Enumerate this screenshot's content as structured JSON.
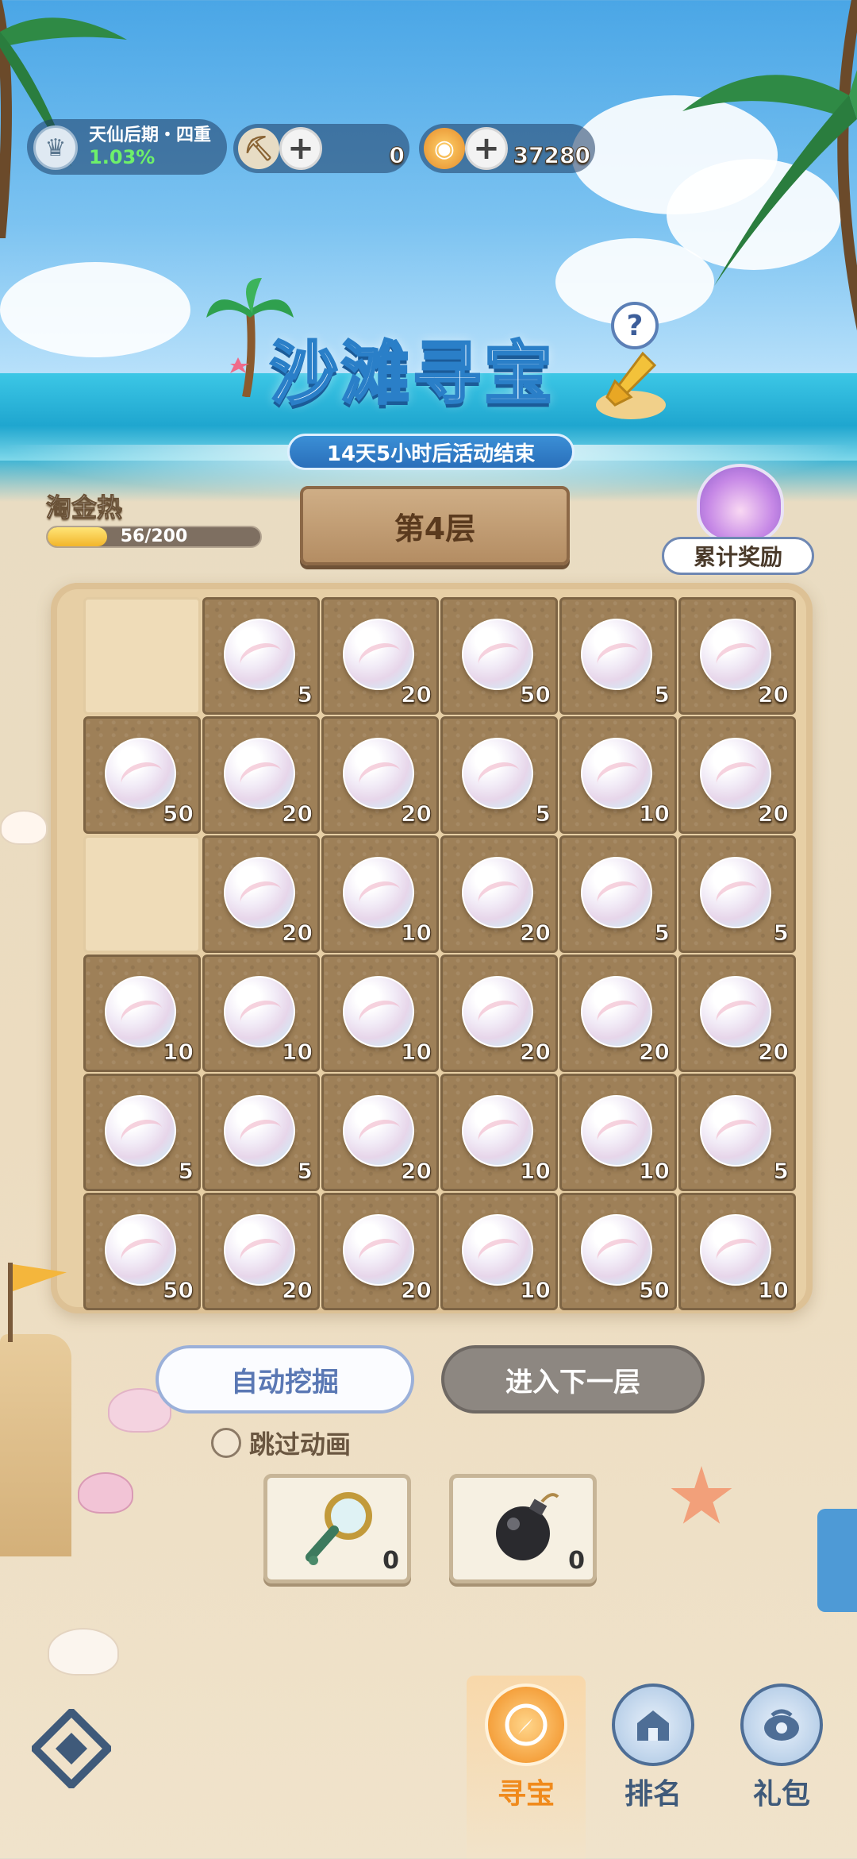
{
  "status": {
    "realm": "天仙后期・四重",
    "realm_progress": "1.03%",
    "shovels": "0",
    "coins": "37280"
  },
  "event": {
    "title": "沙滩寻宝",
    "timer": "14天5小时后活动结束",
    "help": "?"
  },
  "heat": {
    "label": "淘金热",
    "value": "56/200",
    "fraction": 0.28
  },
  "floor": {
    "label": "第4层"
  },
  "reward": {
    "label": "累计奖励"
  },
  "grid": {
    "rows": [
      [
        null,
        "5",
        "20",
        "50",
        "5",
        "20"
      ],
      [
        "50",
        "20",
        "20",
        "5",
        "10",
        "20"
      ],
      [
        null,
        "20",
        "10",
        "20",
        "5",
        "5"
      ],
      [
        "10",
        "10",
        "10",
        "20",
        "20",
        "20"
      ],
      [
        "5",
        "5",
        "20",
        "10",
        "10",
        "5"
      ],
      [
        "50",
        "20",
        "20",
        "10",
        "50",
        "10"
      ]
    ]
  },
  "actions": {
    "auto_dig": "自动挖掘",
    "next_floor": "进入下一层",
    "skip_animation": "跳过动画"
  },
  "items": {
    "magnifier_count": "0",
    "bomb_count": "0"
  },
  "nav": {
    "treasure": "寻宝",
    "ranking": "排名",
    "gift": "礼包"
  },
  "colors": {
    "active_nav": "#f08a1c",
    "inactive_nav": "#3f5a7a",
    "heat_fill": "#f2b52b"
  }
}
